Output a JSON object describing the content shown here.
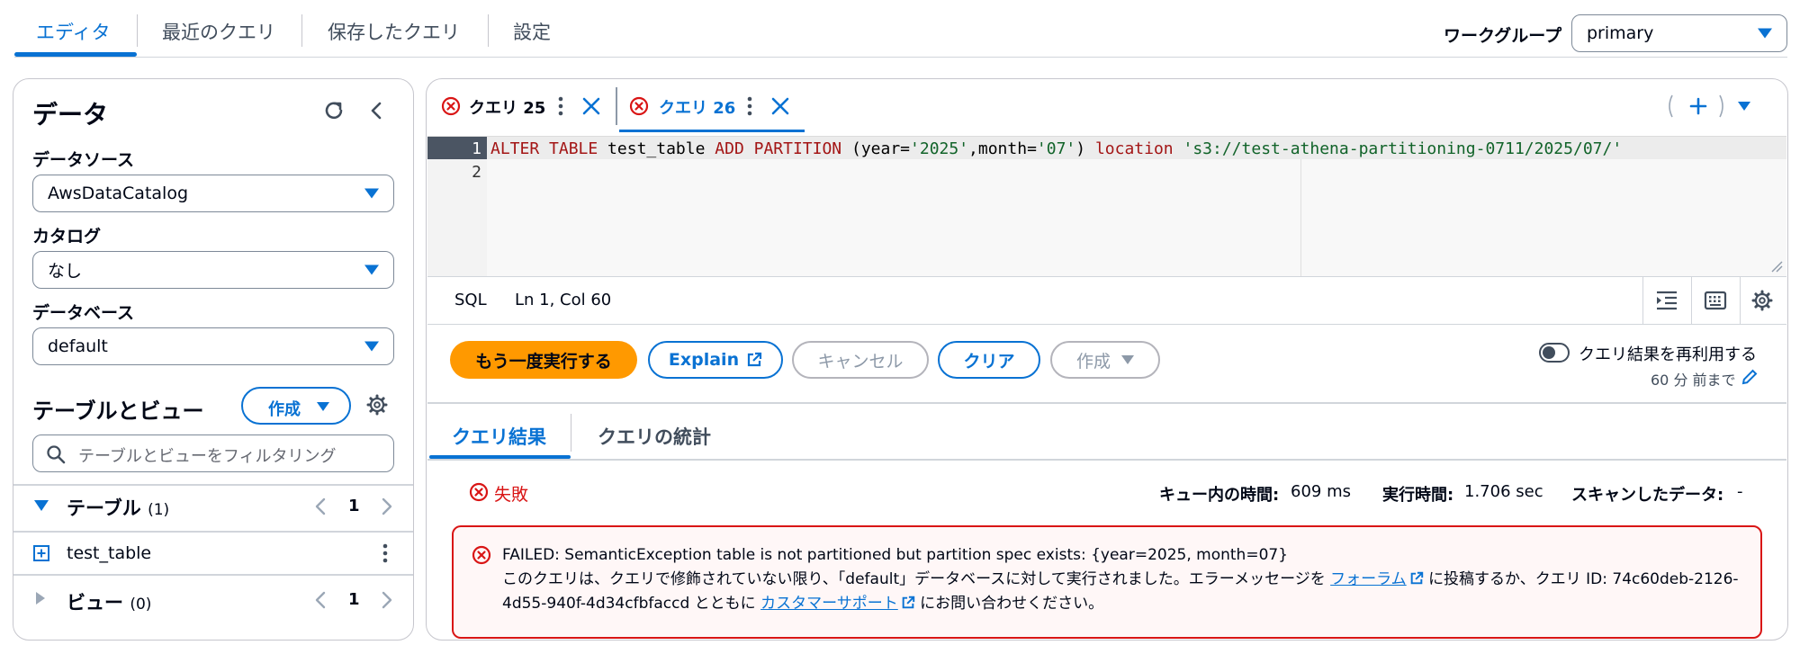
{
  "top_nav": {
    "tabs": [
      {
        "label": "エディタ",
        "active": true
      },
      {
        "label": "最近のクエリ"
      },
      {
        "label": "保存したクエリ"
      },
      {
        "label": "設定"
      }
    ],
    "workgroup_label": "ワークグループ",
    "workgroup_value": "primary"
  },
  "left": {
    "title": "データ",
    "data_source_label": "データソース",
    "data_source_value": "AwsDataCatalog",
    "catalog_label": "カタログ",
    "catalog_value": "なし",
    "database_label": "データベース",
    "database_value": "default",
    "tables_views_title": "テーブルとビュー",
    "create_label": "作成",
    "filter_placeholder": "テーブルとビューをフィルタリング",
    "tables_label": "テーブル",
    "tables_count": "(1)",
    "tables_page": "1",
    "table_item": "test_table",
    "views_label": "ビュー",
    "views_count": "(0)",
    "views_page": "1"
  },
  "query_tabs": [
    {
      "label": "クエリ 25",
      "active": false
    },
    {
      "label": "クエリ 26",
      "active": true
    }
  ],
  "editor": {
    "line1_no": "1",
    "line2_no": "2",
    "line1_tokens": {
      "kw1": "ALTER TABLE",
      "t1": " test_table ",
      "kw2": "ADD PARTITION",
      "t2": " (year=",
      "s1": "'2025'",
      "t3": ",month=",
      "s2": "'07'",
      "t4": ") ",
      "kw3": "location",
      "t5": " ",
      "s3": "'s3://test-athena-partitioning-0711/2025/07/'"
    },
    "language": "SQL",
    "position": "Ln 1, Col 60"
  },
  "actions": {
    "run_again": "もう一度実行する",
    "explain": "Explain",
    "cancel": "キャンセル",
    "clear": "クリア",
    "create": "作成",
    "reuse_label": "クエリ結果を再利用する",
    "reuse_sub": "60 分 前まで"
  },
  "results": {
    "tab_results": "クエリ結果",
    "tab_stats": "クエリの統計",
    "status": "失敗",
    "queue_label": "キュー内の時間:",
    "queue_value": "609 ms",
    "exec_label": "実行時間:",
    "exec_value": "1.706 sec",
    "scan_label": "スキャンしたデータ:",
    "scan_value": "-",
    "error_title": "FAILED: SemanticException table is not partitioned but partition spec exists: {year=2025, month=07}",
    "error_msg_1": "このクエリは、クエリで修飾されていない限り、「default」データベースに対して実行されました。エラーメッセージを",
    "error_forum_link": "フォーラム",
    "error_msg_2": "に投稿するか、クエリ ID:",
    "error_query_id": "74c60deb-2126-4d55-940f-4d34cfbfaccd",
    "error_msg_3": "とともに",
    "error_support_link": "カスタマーサポート",
    "error_msg_4": "にお問い合わせください。"
  },
  "colors": {
    "accent": "#0972d3",
    "primary_button": "#ff9900",
    "error": "#d91515"
  }
}
